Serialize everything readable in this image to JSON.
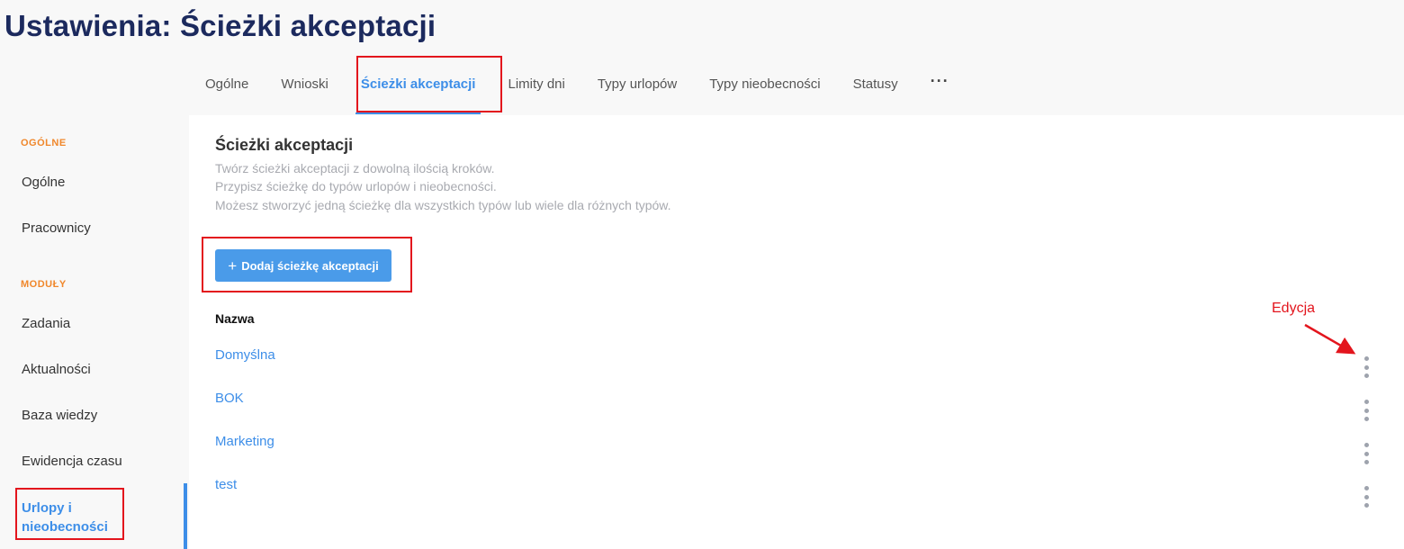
{
  "page": {
    "title": "Ustawienia: Ścieżki akceptacji"
  },
  "tabs": [
    {
      "label": "Ogólne"
    },
    {
      "label": "Wnioski"
    },
    {
      "label": "Ścieżki akceptacji"
    },
    {
      "label": "Limity dni"
    },
    {
      "label": "Typy urlopów"
    },
    {
      "label": "Typy nieobecności"
    },
    {
      "label": "Statusy"
    },
    {
      "label": "···"
    }
  ],
  "active_tab": "Ścieżki akceptacji",
  "sidebar": {
    "section_general": "OGÓLNE",
    "general_items": [
      "Ogólne",
      "Pracownicy"
    ],
    "section_modules": "MODUŁY",
    "module_items": [
      "Zadania",
      "Aktualności",
      "Baza wiedzy",
      "Ewidencja czasu"
    ],
    "active_item_line1": "Urlopy i",
    "active_item_line2": "nieobecności"
  },
  "main": {
    "title": "Ścieżki akceptacji",
    "description": [
      "Twórz ścieżki akceptacji z dowolną ilością kroków.",
      "Przypisz ścieżkę do typów urlopów i nieobecności.",
      "Możesz stworzyć jedną ścieżkę dla wszystkich typów lub wiele dla różnych typów."
    ],
    "add_button_icon": "+",
    "add_button_label": "Dodaj ścieżkę akceptacji",
    "column_header": "Nazwa",
    "rows": [
      "Domyślna",
      "BOK",
      "Marketing",
      "test"
    ]
  },
  "annotation": {
    "label": "Edycja"
  },
  "colors": {
    "accent": "#3d8ee8",
    "title": "#1c2a5e",
    "section": "#f0872b",
    "highlight": "#e3151d"
  }
}
